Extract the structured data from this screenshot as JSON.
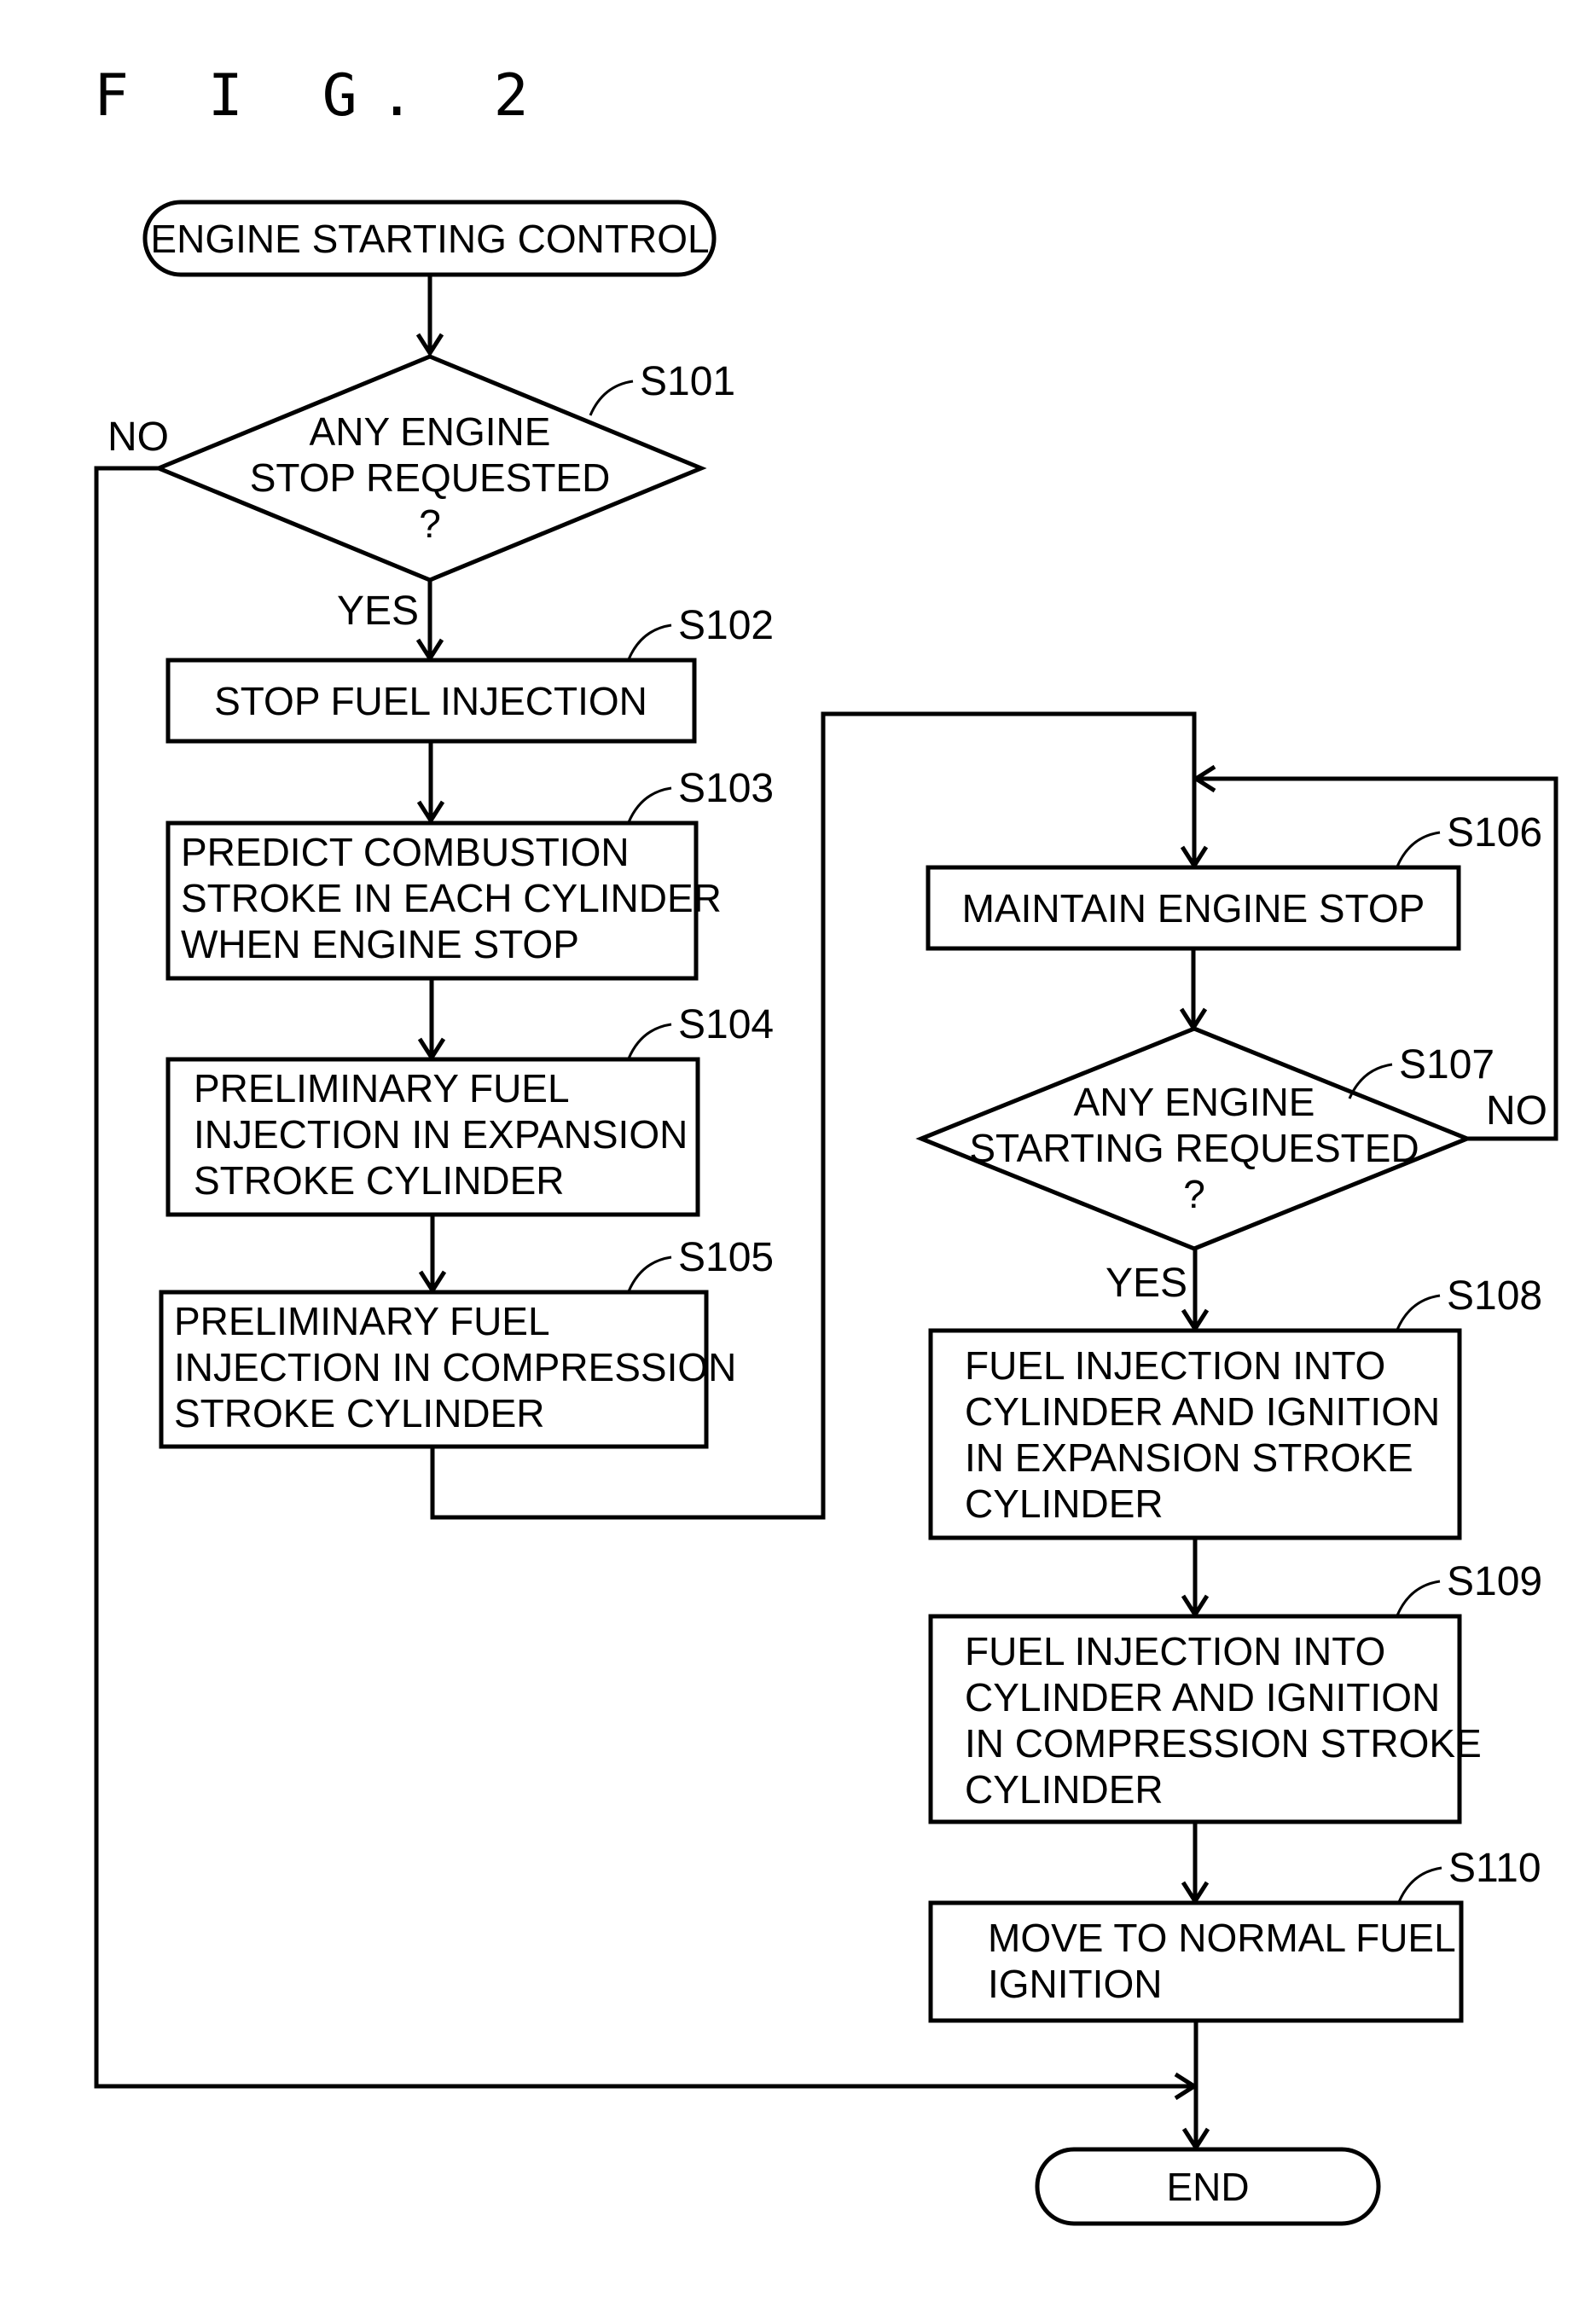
{
  "figure": {
    "title": "F I G. 2"
  },
  "flowchart": {
    "start": "ENGINE STARTING CONTROL",
    "end": "END",
    "branch_labels": {
      "yes": "YES",
      "no": "NO"
    },
    "steps": [
      {
        "id": "S101",
        "type": "decision",
        "lines": [
          "ANY ENGINE",
          "STOP REQUESTED",
          "?"
        ]
      },
      {
        "id": "S102",
        "type": "process",
        "lines": [
          "STOP FUEL INJECTION"
        ]
      },
      {
        "id": "S103",
        "type": "process",
        "lines": [
          "PREDICT COMBUSTION",
          "STROKE IN EACH CYLINDER",
          "WHEN ENGINE STOP"
        ]
      },
      {
        "id": "S104",
        "type": "process",
        "lines": [
          "PRELIMINARY FUEL",
          "INJECTION IN EXPANSION",
          "STROKE CYLINDER"
        ]
      },
      {
        "id": "S105",
        "type": "process",
        "lines": [
          "PRELIMINARY FUEL",
          "INJECTION IN COMPRESSION",
          "STROKE CYLINDER"
        ]
      },
      {
        "id": "S106",
        "type": "process",
        "lines": [
          "MAINTAIN ENGINE STOP"
        ]
      },
      {
        "id": "S107",
        "type": "decision",
        "lines": [
          "ANY ENGINE",
          "STARTING REQUESTED",
          "?"
        ]
      },
      {
        "id": "S108",
        "type": "process",
        "lines": [
          "FUEL INJECTION INTO",
          "CYLINDER AND IGNITION",
          "IN EXPANSION STROKE",
          "CYLINDER"
        ]
      },
      {
        "id": "S109",
        "type": "process",
        "lines": [
          "FUEL INJECTION INTO",
          "CYLINDER AND IGNITION",
          "IN COMPRESSION STROKE",
          "CYLINDER"
        ]
      },
      {
        "id": "S110",
        "type": "process",
        "lines": [
          "MOVE TO NORMAL FUEL",
          "IGNITION"
        ]
      }
    ]
  }
}
